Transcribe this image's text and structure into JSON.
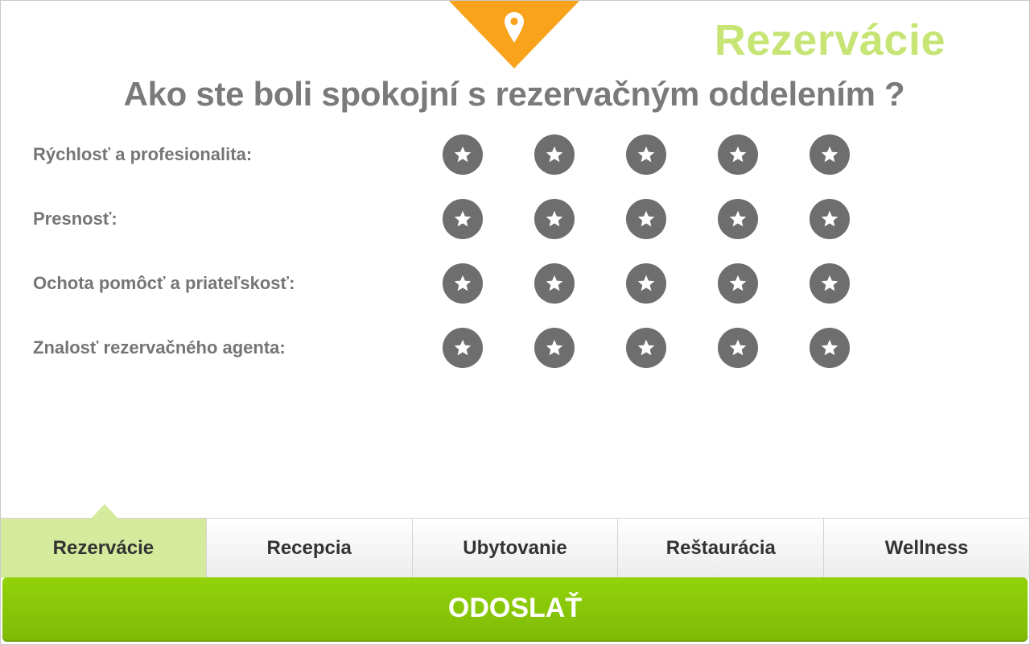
{
  "header": {
    "section_title": "Rezervácie",
    "question": "Ako ste boli spokojní s rezervačným oddelením ?",
    "banner_color": "#f8a31b",
    "banner_icon": "map-pin-icon"
  },
  "ratings": [
    {
      "label": "Rýchlosť a profesionalita:",
      "max_stars": 5,
      "selected": 0
    },
    {
      "label": "Presnosť:",
      "max_stars": 5,
      "selected": 0
    },
    {
      "label": "Ochota pomôcť a priateľskosť:",
      "max_stars": 5,
      "selected": 0
    },
    {
      "label": "Znalosť rezervačného agenta:",
      "max_stars": 5,
      "selected": 0
    }
  ],
  "star_icon": "star-icon",
  "tabs": [
    {
      "label": "Rezervácie",
      "active": true
    },
    {
      "label": "Recepcia",
      "active": false
    },
    {
      "label": "Ubytovanie",
      "active": false
    },
    {
      "label": "Reštaurácia",
      "active": false
    },
    {
      "label": "Wellness",
      "active": false
    }
  ],
  "submit": {
    "label": "ODOSLAŤ"
  },
  "colors": {
    "accent_green": "#8cc90a",
    "title_green": "#c6e575",
    "active_tab": "#d5ea9c",
    "star_circle": "#6e6e6e",
    "text_gray": "#7a7a7a"
  }
}
